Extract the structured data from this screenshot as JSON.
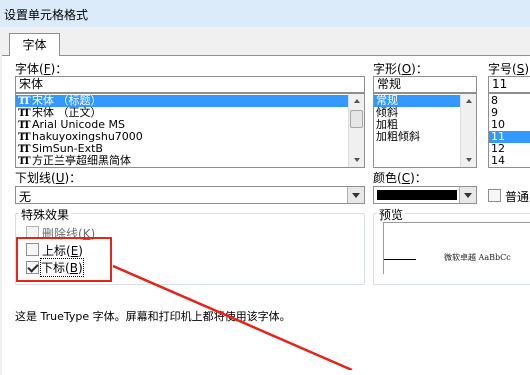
{
  "window": {
    "title": "设置单元格格式"
  },
  "tabs": [
    {
      "label": "字体"
    }
  ],
  "font": {
    "label": "字体",
    "hotkey": "F",
    "value": "宋体",
    "items": [
      {
        "name": "宋体 （标题）",
        "selected": true
      },
      {
        "name": "宋体 （正文）",
        "selected": false
      },
      {
        "name": "Arial Unicode MS",
        "selected": false
      },
      {
        "name": "hakuyoxingshu7000",
        "selected": false
      },
      {
        "name": "SimSun-ExtB",
        "selected": false
      },
      {
        "name": "方正兰亭超细黑简体",
        "selected": false
      }
    ]
  },
  "style": {
    "label": "字形",
    "hotkey": "O",
    "value": "常规",
    "items": [
      {
        "name": "常规",
        "selected": true
      },
      {
        "name": "倾斜",
        "selected": false
      },
      {
        "name": "加粗",
        "selected": false
      },
      {
        "name": "加粗倾斜",
        "selected": false
      }
    ]
  },
  "size": {
    "label": "字号",
    "hotkey": "S",
    "value": "11",
    "items": [
      {
        "name": "8",
        "selected": false
      },
      {
        "name": "9",
        "selected": false
      },
      {
        "name": "10",
        "selected": false
      },
      {
        "name": "11",
        "selected": true
      },
      {
        "name": "12",
        "selected": false
      },
      {
        "name": "14",
        "selected": false
      }
    ]
  },
  "underline": {
    "label": "下划线",
    "hotkey": "U",
    "value": "无"
  },
  "color": {
    "label": "颜色",
    "hotkey": "C",
    "value_color": "#000000",
    "normal_font_label": "普通字"
  },
  "effects": {
    "title": "特殊效果",
    "strikethrough": {
      "label": "删除线",
      "hotkey": "K",
      "checked": false,
      "enabled": false
    },
    "superscript": {
      "label": "上标",
      "hotkey": "E",
      "checked": false
    },
    "subscript": {
      "label": "下标",
      "hotkey": "B",
      "checked": true
    }
  },
  "preview": {
    "title": "预览",
    "sample_text": "微软卓越  AaBbCc"
  },
  "footer_note": "这是 TrueType 字体。屏幕和打印机上都将使用该字体。",
  "annotation_color": "#e8231a"
}
